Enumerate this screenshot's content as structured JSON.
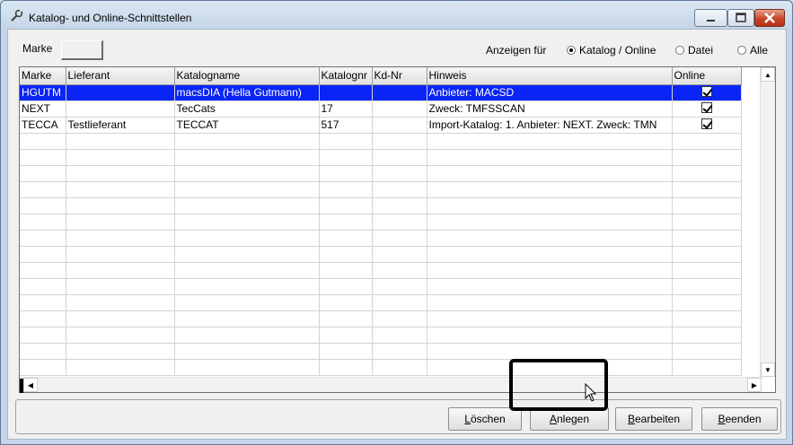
{
  "window": {
    "title": "Katalog- und Online-Schnittstellen"
  },
  "filter": {
    "marke_label": "Marke",
    "marke_value": "",
    "anzeigen_label": "Anzeigen für",
    "options": [
      {
        "label": "Katalog / Online",
        "selected": true
      },
      {
        "label": "Datei",
        "selected": false
      },
      {
        "label": "Alle",
        "selected": false
      }
    ]
  },
  "table": {
    "columns": [
      "Marke",
      "Lieferant",
      "Katalogname",
      "Katalognr",
      "Kd-Nr",
      "Hinweis",
      "Online"
    ],
    "rows": [
      {
        "marke": "HGUTM",
        "lieferant": "",
        "katalogname": "macsDIA (Hella Gutmann)",
        "katalognr": "",
        "kdnr": "",
        "hinweis": "Anbieter: MACSD",
        "online": true
      },
      {
        "marke": "NEXT",
        "lieferant": "",
        "katalogname": "TecCats",
        "katalognr": "17",
        "kdnr": "",
        "hinweis": "Zweck: TMFSSCAN",
        "online": true
      },
      {
        "marke": "TECCA",
        "lieferant": "Testlieferant",
        "katalogname": "TECCAT",
        "katalognr": "517",
        "kdnr": "",
        "hinweis": "Import-Katalog: 1. Anbieter: NEXT. Zweck: TMN",
        "online": true
      }
    ]
  },
  "buttons": {
    "loeschen": "Löschen",
    "anlegen": "Anlegen",
    "bearbeiten": "Bearbeiten",
    "beenden": "Beenden"
  }
}
